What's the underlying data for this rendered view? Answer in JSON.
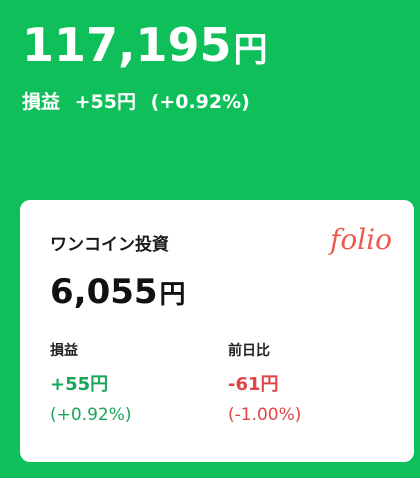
{
  "summary": {
    "total_value": "117,195",
    "total_unit": "円",
    "pl_label": "損益",
    "pl_amount": "+55円",
    "pl_percent": "(+0.92%)"
  },
  "card": {
    "title": "ワンコイン投資",
    "logo_text": "folio",
    "value": "6,055",
    "value_unit": "円",
    "profit": {
      "label": "損益",
      "amount": "+55円",
      "percent": "(+0.92%)"
    },
    "day_change": {
      "label": "前日比",
      "amount": "-61円",
      "percent": "(-1.00%)"
    }
  },
  "colors": {
    "background": "#0fbf5a",
    "positive": "#1aa65a",
    "negative": "#e04545",
    "brand": "#ef5a4f"
  }
}
